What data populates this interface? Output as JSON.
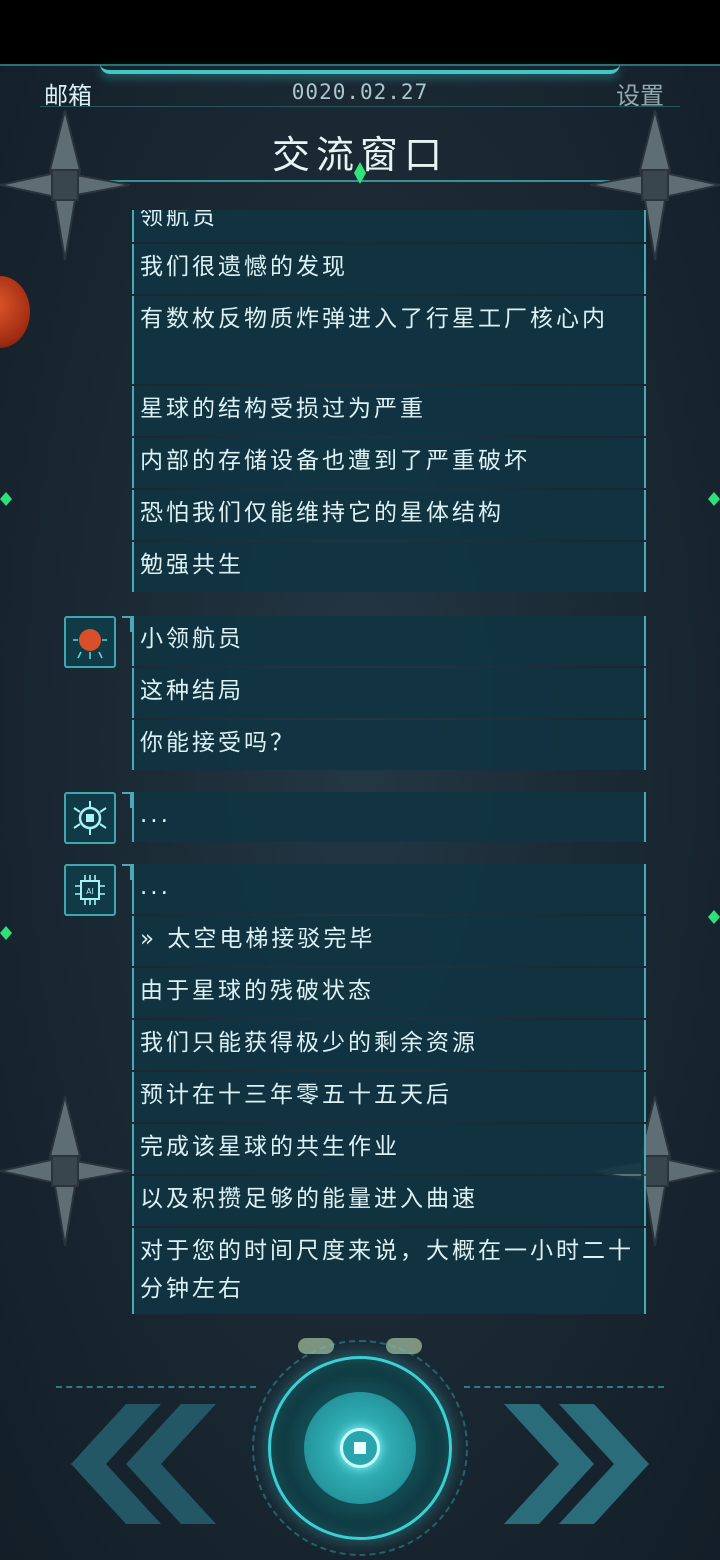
{
  "header": {
    "mailbox": "邮箱",
    "date": "0020.02.27",
    "settings": "设置",
    "title": "交流窗口"
  },
  "messages": [
    {
      "text": "领航员",
      "partial": true
    },
    {
      "text": "我们很遗憾的发现"
    },
    {
      "text": "有数枚反物质炸弹进入了行星工厂核心内"
    },
    {
      "text": "星球的结构受损过为严重"
    },
    {
      "text": "内部的存储设备也遭到了严重破坏"
    },
    {
      "text": "恐怕我们仅能维持它的星体结构"
    },
    {
      "text": "勉强共生"
    },
    {
      "text": "小领航员",
      "avatar": "planet-core-avatar"
    },
    {
      "text": "这种结局"
    },
    {
      "text": "你能接受吗？"
    },
    {
      "text": "...",
      "avatar": "chip-bug-avatar"
    },
    {
      "text": "...",
      "avatar": "ai-chip-avatar"
    },
    {
      "text": "» 太空电梯接驳完毕"
    },
    {
      "text": "由于星球的残破状态"
    },
    {
      "text": "我们只能获得极少的剩余资源"
    },
    {
      "text": "预计在十三年零五十五天后"
    },
    {
      "text": "完成该星球的共生作业"
    },
    {
      "text": "以及积攒足够的能量进入曲速"
    },
    {
      "text": "对于您的时间尺度来说，大概在一小时二十分钟左右"
    }
  ],
  "controls": {
    "prev_icon": "double-chevron-left-icon",
    "next_icon": "double-chevron-right-icon",
    "center_icon": "record-button-icon"
  },
  "colors": {
    "accent": "#3ec9c6",
    "bubble_bg": "#10344a",
    "border": "#4da8b5",
    "gem": "#2fe57b"
  }
}
